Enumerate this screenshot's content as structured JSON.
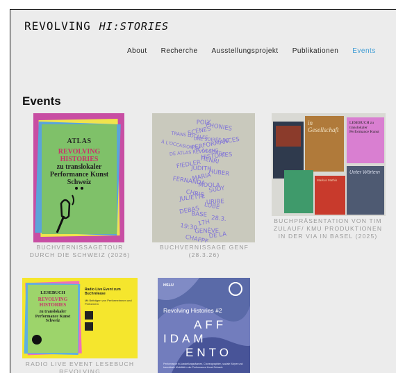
{
  "logo": {
    "part1": "REVOLVING",
    "part2": "HI:STORIES"
  },
  "nav": {
    "items": [
      "About",
      "Recherche",
      "Ausstellungsprojekt",
      "Publikationen",
      "Events"
    ],
    "active_index": 4,
    "active_color": "#3d9bd4"
  },
  "page": {
    "title": "Events"
  },
  "events": [
    {
      "caption": "BUCHVERNISSAGETOUR DURCH DIE SCHWEIZ (2026)",
      "cover": {
        "kicker": "ATLAS",
        "title": "REVOLVING HISTORIES",
        "subtitle": "zu translokaler Performance Kunst Schweiz"
      }
    },
    {
      "caption": "BUCHVERNISSAGE GENF (28.3.26)",
      "cover": {
        "lines": [
          "POLY",
          "PHONIES",
          "SCÉNES",
          "TRANS LOCALES",
          "UNE SOIRÉE DE",
          "PERFORMANCES",
          "À L'OCCASION DE LA SORTIE",
          "DE ATLAS REVOLVING",
          "HISTORIES",
          "HENRI",
          "FIEDLER",
          "JUDITH",
          "HUBER",
          "MARIA",
          "FERNANDA",
          "MOOLA",
          "SUDY",
          "CHRIS",
          "JULIETTE",
          "URIBE",
          "LOBE",
          "DEBAS",
          "BASE",
          "28.3.",
          "17H",
          "19:30",
          "GENÈVE",
          "DE LA",
          "CHAPPE"
        ]
      }
    },
    {
      "caption": "BUCHPRÄSENTATION VON TIM ZULAUF/ KMU PRODUKTIONEN IN DER VIA IN BASEL (2025)",
      "cover": {
        "book1": "in Gesellschaft",
        "book2": "LESEBUCH zu translokaler Performance Kunst",
        "book3": "Markus Mathis",
        "book4": "Unter Wörtern"
      }
    },
    {
      "caption": "RADIO LIVE EVENT LESEBUCH REVOLVING",
      "cover": {
        "kicker": "LESEBUCH",
        "title": "REVOLVING HISTORIES",
        "subtitle": "zu translokaler Performance Kunst Schweiz",
        "side_title": "Radio Live Event zum Buchrelease",
        "side_text": "Mit Beiträgen von Performerinnen und Performern"
      }
    },
    {
      "caption": "",
      "cover": {
        "label": "HSLU",
        "title": "Revolving Histories #2",
        "big": [
          "AFF",
          "IDAM",
          "ENTO"
        ],
        "footer": "Performance in Ausstellungsräumen, Choreographien, soziale Körper und translokale Mobilität in der Performance Kunst Schweiz"
      }
    }
  ]
}
